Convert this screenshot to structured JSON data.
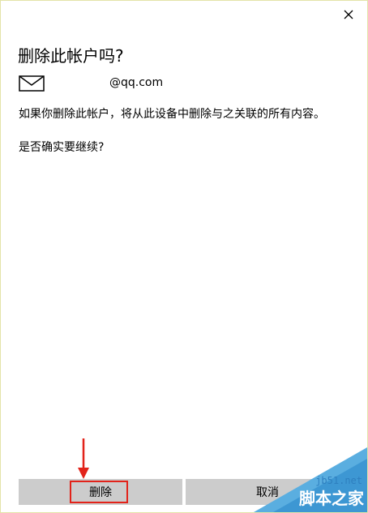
{
  "dialog": {
    "title": "删除此帐户吗?",
    "email": "@qq.com",
    "message": "如果你删除此帐户，将从此设备中删除与之关联的所有内容。",
    "question": "是否确实要继续?",
    "close_icon": "close-icon",
    "mail_icon": "mail-icon"
  },
  "buttons": {
    "delete_label": "删除",
    "cancel_label": "取消"
  },
  "annotation": {
    "highlight_color": "#e2231a"
  },
  "watermark": {
    "url": "jb51.net",
    "name": "脚本之家"
  }
}
